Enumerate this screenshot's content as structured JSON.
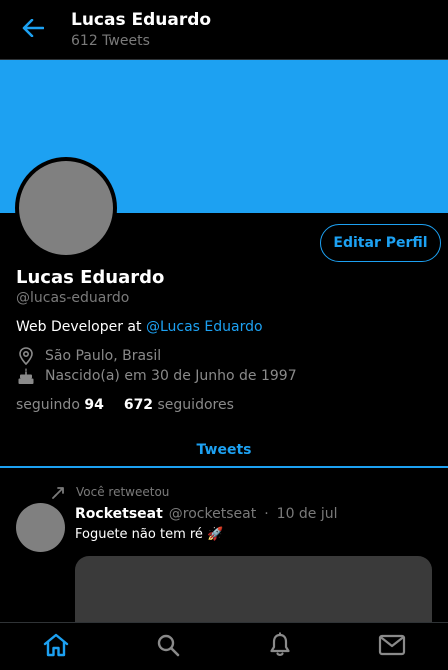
{
  "header": {
    "name": "Lucas Eduardo",
    "tweet_count": "612 Tweets",
    "back_icon": "arrow-left-icon"
  },
  "colors": {
    "accent": "#1da1f2",
    "background": "#000000",
    "avatar_placeholder": "#808080",
    "muted_text": "#7a7a7a"
  },
  "profile": {
    "edit_button": "Editar Perfil",
    "name": "Lucas Eduardo",
    "handle": "@lucas-eduardo",
    "bio_prefix": "Web Developer at ",
    "bio_link": "@Lucas Eduardo",
    "location": "São Paulo, Brasil",
    "location_icon": "map-pin-icon",
    "birthday": "Nascido(a) em 30 de Junho de 1997",
    "birthday_icon": "cake-icon",
    "following_label": "seguindo",
    "following_count": "94",
    "followers_count": "672",
    "followers_label": "seguidores"
  },
  "tabs": {
    "active": "Tweets"
  },
  "tweet": {
    "retweet_text": "Você retweetou",
    "retweet_icon": "retweet-icon",
    "author": "Rocketseat",
    "handle": "@rocketseat",
    "separator": "·",
    "date": "10 de jul",
    "text": "Foguete não tem ré 🚀"
  },
  "bottom_nav": {
    "items": [
      "home-icon",
      "search-icon",
      "bell-icon",
      "mail-icon"
    ],
    "active": "home-icon"
  }
}
